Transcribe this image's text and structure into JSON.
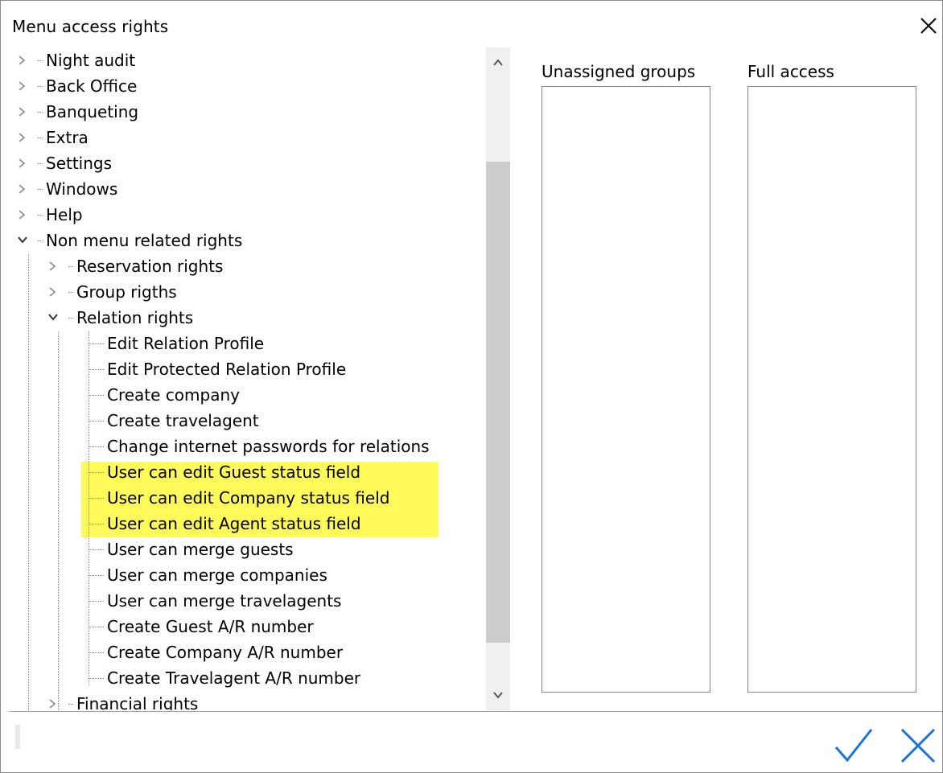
{
  "window": {
    "title": "Menu access rights",
    "close_icon": "close-icon"
  },
  "tree": {
    "items": [
      {
        "label": "Night audit",
        "state": "collapsed"
      },
      {
        "label": "Back Office",
        "state": "collapsed"
      },
      {
        "label": "Banqueting",
        "state": "collapsed"
      },
      {
        "label": "Extra",
        "state": "collapsed"
      },
      {
        "label": "Settings",
        "state": "collapsed"
      },
      {
        "label": "Windows",
        "state": "collapsed"
      },
      {
        "label": "Help",
        "state": "collapsed"
      },
      {
        "label": "Non menu related rights",
        "state": "expanded"
      },
      {
        "label": "Reservation rights",
        "state": "collapsed"
      },
      {
        "label": "Group rigths",
        "state": "collapsed"
      },
      {
        "label": "Relation rights",
        "state": "expanded"
      },
      {
        "label": "Edit Relation Profile",
        "state": "leaf"
      },
      {
        "label": "Edit Protected Relation Profile",
        "state": "leaf"
      },
      {
        "label": "Create company",
        "state": "leaf"
      },
      {
        "label": "Create travelagent",
        "state": "leaf"
      },
      {
        "label": "Change internet passwords for relations",
        "state": "leaf"
      },
      {
        "label": "User can edit Guest status field",
        "state": "leaf",
        "highlighted": true
      },
      {
        "label": "User can edit Company status field",
        "state": "leaf",
        "highlighted": true
      },
      {
        "label": "User can edit Agent status field",
        "state": "leaf",
        "highlighted": true
      },
      {
        "label": "User can merge guests",
        "state": "leaf"
      },
      {
        "label": "User can merge companies",
        "state": "leaf"
      },
      {
        "label": "User can merge travelagents",
        "state": "leaf"
      },
      {
        "label": "Create Guest A/R number",
        "state": "leaf"
      },
      {
        "label": "Create Company  A/R number",
        "state": "leaf"
      },
      {
        "label": "Create Travelagent  A/R number",
        "state": "leaf"
      },
      {
        "label": "Financial rights",
        "state": "collapsed"
      }
    ],
    "highlight_color": "#fffb5a"
  },
  "groups": {
    "unassigned_label": "Unassigned groups",
    "full_access_label": "Full access"
  },
  "footer": {
    "ok_icon": "checkmark-icon",
    "cancel_icon": "cancel-x-icon",
    "accent_color": "#1e73d6"
  }
}
